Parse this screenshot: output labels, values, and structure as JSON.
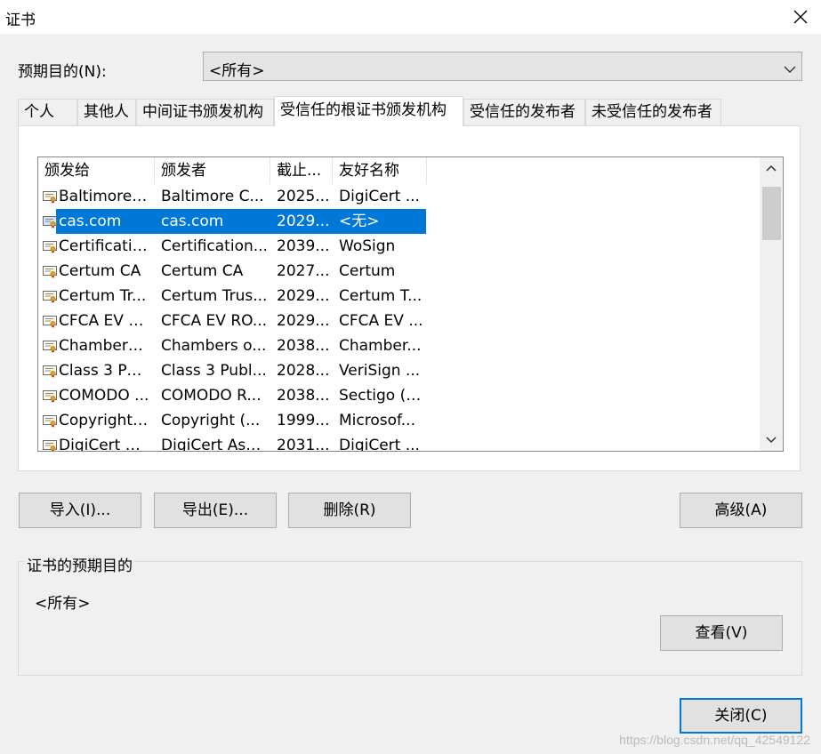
{
  "window": {
    "title": "证书"
  },
  "purpose": {
    "label": "预期目的(N):",
    "value": "<所有>"
  },
  "tabs": [
    "个人",
    "其他人",
    "中间证书颁发机构",
    "受信任的根证书颁发机构",
    "受信任的发布者",
    "未受信任的发布者"
  ],
  "active_tab_index": 3,
  "list": {
    "columns": [
      "颁发给",
      "颁发者",
      "截止...",
      "友好名称"
    ],
    "rows": [
      [
        "Baltimore ...",
        "Baltimore C...",
        "2025...",
        "DigiCert ..."
      ],
      [
        "cas.com",
        "cas.com",
        "2029...",
        "<无>"
      ],
      [
        "Certificatio...",
        "Certification...",
        "2039...",
        "WoSign"
      ],
      [
        "Certum CA",
        "Certum CA",
        "2027...",
        "Certum"
      ],
      [
        "Certum Tr...",
        "Certum Trus...",
        "2029...",
        "Certum T..."
      ],
      [
        "CFCA EV R...",
        "CFCA EV RO...",
        "2029...",
        "CFCA EV ..."
      ],
      [
        "Chambers ...",
        "Chambers o...",
        "2038...",
        "Chamber..."
      ],
      [
        "Class 3 Pu...",
        "Class 3 Publ...",
        "2028...",
        "VeriSign ..."
      ],
      [
        "COMODO ...",
        "COMODO R...",
        "2038...",
        "Sectigo (f..."
      ],
      [
        "Copyright ...",
        "Copyright (...",
        "1999...",
        "Microsof..."
      ],
      [
        "DigiCert A...",
        "DigiCert Ass...",
        "2031...",
        "DigiCert ..."
      ]
    ],
    "selected_row_index": 1
  },
  "buttons": {
    "import": "导入(I)...",
    "export": "导出(E)...",
    "remove": "删除(R)",
    "advanced": "高级(A)",
    "view": "查看(V)",
    "close": "关闭(C)"
  },
  "purposes_group": {
    "label": "证书的预期目的",
    "value": "<所有>"
  },
  "watermark": "https://blog.csdn.net/qq_42549122",
  "colors": {
    "selection": "#0078d7",
    "window_bg": "#f0f0f0",
    "default_button_border": "#0078d7"
  },
  "icons": {
    "window_close": "close-icon",
    "combo": "chevron-down-icon",
    "cert": "certificate-icon"
  }
}
